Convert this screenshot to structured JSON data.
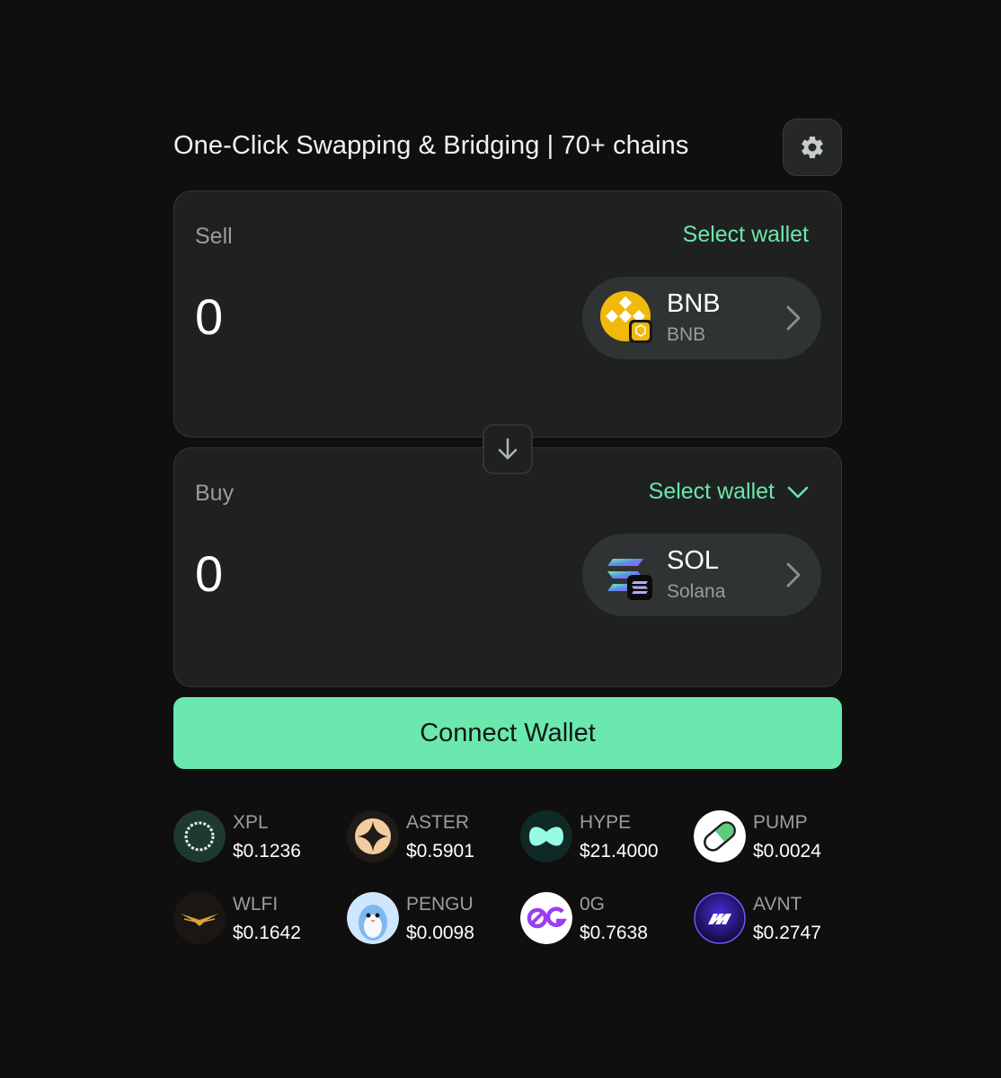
{
  "header": {
    "title": "One-Click Swapping & Bridging | 70+ chains",
    "settings_icon": "gear-icon"
  },
  "sell": {
    "label": "Sell",
    "wallet_label": "Select wallet",
    "amount": "0",
    "token": {
      "symbol": "BNB",
      "chain": "BNB",
      "color": "#f0b90b"
    }
  },
  "buy": {
    "label": "Buy",
    "wallet_label": "Select wallet",
    "amount": "0",
    "token": {
      "symbol": "SOL",
      "chain": "Solana"
    }
  },
  "switch_icon": "arrow-down-icon",
  "connect_button": "Connect Wallet",
  "colors": {
    "accent": "#6be8ae",
    "panel": "#1f2121",
    "background": "#0f0f0f"
  },
  "tokens": [
    {
      "symbol": "XPL",
      "price": "$0.1236",
      "icon": "xpl-icon"
    },
    {
      "symbol": "ASTER",
      "price": "$0.5901",
      "icon": "aster-icon"
    },
    {
      "symbol": "HYPE",
      "price": "$21.4000",
      "icon": "hype-icon"
    },
    {
      "symbol": "PUMP",
      "price": "$0.0024",
      "icon": "pump-icon"
    },
    {
      "symbol": "WLFI",
      "price": "$0.1642",
      "icon": "wlfi-icon"
    },
    {
      "symbol": "PENGU",
      "price": "$0.0098",
      "icon": "pengu-icon"
    },
    {
      "symbol": "0G",
      "price": "$0.7638",
      "icon": "0g-icon"
    },
    {
      "symbol": "AVNT",
      "price": "$0.2747",
      "icon": "avnt-icon"
    }
  ]
}
